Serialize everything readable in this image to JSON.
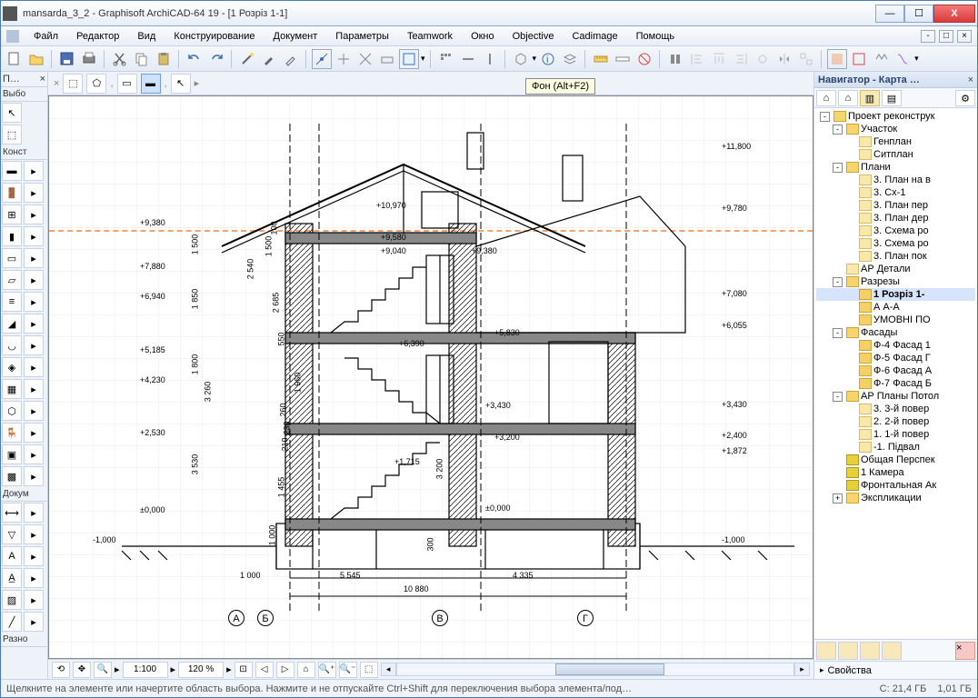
{
  "window": {
    "title": "mansarda_3_2 - Graphisoft ArchiCAD-64 19 - [1 Розріз 1-1]"
  },
  "win_buttons": {
    "min": "—",
    "max": "☐",
    "close": "X"
  },
  "menu": {
    "items": [
      "Файл",
      "Редактор",
      "Вид",
      "Конструирование",
      "Документ",
      "Параметры",
      "Teamwork",
      "Окно",
      "Objective",
      "Cadimage",
      "Помощь"
    ]
  },
  "tooltip": "Фон (Alt+F2)",
  "left_panels": {
    "p1": "П…",
    "p2": "Выбо",
    "p3": "Конст",
    "p4": "Докум",
    "p5": "Разно"
  },
  "navigator": {
    "title": "Навигатор - Карта …",
    "tree": [
      {
        "lvl": 1,
        "exp": "-",
        "ic": "proj",
        "txt": "Проект реконструк"
      },
      {
        "lvl": 2,
        "exp": "-",
        "ic": "folder",
        "txt": "Участок"
      },
      {
        "lvl": 3,
        "exp": "",
        "ic": "file",
        "txt": "Генплан"
      },
      {
        "lvl": 3,
        "exp": "",
        "ic": "file",
        "txt": "Ситплан"
      },
      {
        "lvl": 2,
        "exp": "-",
        "ic": "folder",
        "txt": "Плани"
      },
      {
        "lvl": 3,
        "exp": "",
        "ic": "file",
        "txt": "3. План на в"
      },
      {
        "lvl": 3,
        "exp": "",
        "ic": "file",
        "txt": "3. Сх-1"
      },
      {
        "lvl": 3,
        "exp": "",
        "ic": "file",
        "txt": "3. План пер"
      },
      {
        "lvl": 3,
        "exp": "",
        "ic": "file",
        "txt": "3. План дер"
      },
      {
        "lvl": 3,
        "exp": "",
        "ic": "file",
        "txt": "3. Схема ро"
      },
      {
        "lvl": 3,
        "exp": "",
        "ic": "file",
        "txt": "3. Схема ро"
      },
      {
        "lvl": 3,
        "exp": "",
        "ic": "file",
        "txt": "3. План пок"
      },
      {
        "lvl": 2,
        "exp": "",
        "ic": "file",
        "txt": "АР Детали"
      },
      {
        "lvl": 2,
        "exp": "-",
        "ic": "folder",
        "txt": "Разрезы"
      },
      {
        "lvl": 3,
        "exp": "",
        "ic": "sec",
        "txt": "1 Розріз 1-",
        "sel": true
      },
      {
        "lvl": 3,
        "exp": "",
        "ic": "sec",
        "txt": "А А-А"
      },
      {
        "lvl": 3,
        "exp": "",
        "ic": "sec",
        "txt": "УМОВНІ ПО"
      },
      {
        "lvl": 2,
        "exp": "-",
        "ic": "folder",
        "txt": "Фасады"
      },
      {
        "lvl": 3,
        "exp": "",
        "ic": "sec",
        "txt": "Ф-4 Фасад 1"
      },
      {
        "lvl": 3,
        "exp": "",
        "ic": "sec",
        "txt": "Ф-5 Фасад Г"
      },
      {
        "lvl": 3,
        "exp": "",
        "ic": "sec",
        "txt": "Ф-6 Фасад А"
      },
      {
        "lvl": 3,
        "exp": "",
        "ic": "sec",
        "txt": "Ф-7 Фасад Б"
      },
      {
        "lvl": 2,
        "exp": "-",
        "ic": "folder",
        "txt": "АР Планы Потол"
      },
      {
        "lvl": 3,
        "exp": "",
        "ic": "file",
        "txt": "3. 3-й повер"
      },
      {
        "lvl": 3,
        "exp": "",
        "ic": "file",
        "txt": "2. 2-й повер"
      },
      {
        "lvl": 3,
        "exp": "",
        "ic": "file",
        "txt": "1. 1-й повер"
      },
      {
        "lvl": 3,
        "exp": "",
        "ic": "file",
        "txt": "-1. Підвал"
      },
      {
        "lvl": 2,
        "exp": "",
        "ic": "cam",
        "txt": "Общая Перспек"
      },
      {
        "lvl": 2,
        "exp": "",
        "ic": "cam",
        "txt": "1 Камера"
      },
      {
        "lvl": 2,
        "exp": "",
        "ic": "cam",
        "txt": "Фронтальная Ак"
      },
      {
        "lvl": 2,
        "exp": "+",
        "ic": "folder",
        "txt": "Экспликации"
      }
    ],
    "properties": "Свойства"
  },
  "zoom": {
    "scale": "1:100",
    "percent": "120 %"
  },
  "status": {
    "hint": "Щелкните на элементе или начертите область выбора. Нажмите и не отпускайте Ctrl+Shift для переключения выбора элемента/под…",
    "c": "C: 21,4 ГБ",
    "d": "1,01 ГБ"
  },
  "elevations_left": [
    "+9,380",
    "+7,880",
    "+6,940",
    "+5,185",
    "+4,230",
    "+2,530",
    "±0,000",
    "-1,000"
  ],
  "elevations_right": [
    "+11,800",
    "+9,780",
    "+7,080",
    "+6,055",
    "+3,430",
    "+2,400",
    "+1,872",
    "-1,000"
  ],
  "elevations_mid": [
    "+10,970",
    "+9,580",
    "+9,040",
    "+9,380",
    "+6,390",
    "+5,830",
    "+3,430",
    "+3,200",
    "+1,715",
    "±0,000"
  ],
  "dims_v": [
    "1 500",
    "1 850",
    "1 800",
    "3 260",
    "3 530",
    "1 500",
    "100",
    "2 540",
    "2 685",
    "550",
    "1 960",
    "260",
    "230",
    "210",
    "1 455",
    "1 000",
    "3 200",
    "300"
  ],
  "dims_h": {
    "a": "1 000",
    "b": "5 545",
    "c": "4 335",
    "total": "10 880"
  },
  "axes": [
    "А",
    "Б",
    "В",
    "Г"
  ]
}
